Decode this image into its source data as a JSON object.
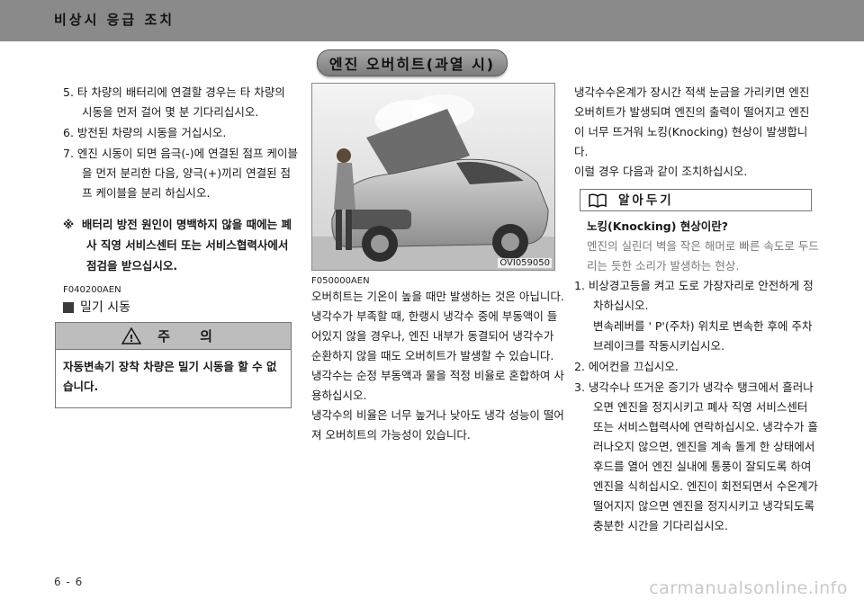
{
  "header": {
    "title": "비상시 응급 조치"
  },
  "section_title": "엔진 오버히트(과열 시)",
  "left": {
    "steps": [
      "5. 타 차량의 배터리에 연결할 경우는 타 차량의 시동을 먼저 걸어 몇 분 기다리십시오.",
      "6. 방전된 차량의 시동을 거십시오.",
      "7. 엔진 시동이 되면 음극(-)에 연결된 점프 케이블을 먼저 분리한 다음, 양극(+)끼리 연결된 점프 케이블을 분리 하십시오."
    ],
    "notice_mark": "※",
    "notice": "배터리 방전 원인이 명백하지 않을 때에는 폐사 직영 서비스센터 또는 서비스협력사에서 점검을 받으십시오.",
    "code": "F040200AEN",
    "sub_heading": "밀기 시동",
    "caution": {
      "title": "주  의",
      "icon_text": "!",
      "body": "자동변속기 장착 차량은 밀기 시동을 할 수 없습니다."
    }
  },
  "middle": {
    "image_caption": "OVI059050",
    "code": "F050000AEN",
    "paragraphs": [
      "오버히트는 기온이 높을 때만 발생하는 것은 아닙니다.",
      "냉각수가 부족할 때, 한랭시 냉각수 중에 부동액이 들어있지 않을 경우나, 엔진 내부가 동결되어 냉각수가 순환하지 않을 때도 오버히트가 발생할 수 있습니다.",
      "냉각수는 순정 부동액과 물을 적정 비율로 혼합하여 사용하십시오.",
      "냉각수의 비율은 너무 높거나 낮아도 냉각 성능이 떨어져 오버히트의 가능성이 있습니다."
    ]
  },
  "right": {
    "intro": "냉각수수온계가 장시간 적색 눈금을 가리키면 엔진 오버히트가 발생되며 엔진의 출력이 떨어지고 엔진이 너무 뜨거워 노킹(Knocking) 현상이 발생합니다.",
    "intro2": "이럴 경우 다음과 같이 조치하십시오.",
    "tip_title": "알아두기",
    "knock_q": "노킹(Knocking) 현상이란?",
    "knock_a": "엔진의 실린더 벽을 작은 해머로 빠른 속도로 두드리는 듯한 소리가 발생하는 현상.",
    "steps": [
      "1. 비상경고등을 켜고 도로 가장자리로 안전하게 정차하십시오.",
      "변속레버를 ' P'(주차) 위치로 변속한 후에 주차 브레이크를 작동시키십시오.",
      "2. 에어컨을 끄십시오.",
      "3. 냉각수나 뜨거운 증기가 냉각수 탱크에서 흘러나오면 엔진을 정지시키고 폐사 직영 서비스센터 또는 서비스협력사에 연락하십시오. 냉각수가 흘러나오지 않으면, 엔진을 계속 돌게 한 상태에서 후드를 열어 엔진 실내에 통풍이 잘되도록 하여 엔진을 식히십시오. 엔진이 회전되면서 수온계가 떨어지지 않으면 엔진을 정지시키고 냉각되도록 충분한 시간을 기다리십시오."
    ]
  },
  "footer": {
    "page_number": "6 - 6",
    "watermark": "carmanualsonline.info"
  },
  "colors": {
    "header_bg": "#8a8a8a",
    "pill_bg": "#9a9a9a",
    "caution_head": "#bdbdbd"
  }
}
